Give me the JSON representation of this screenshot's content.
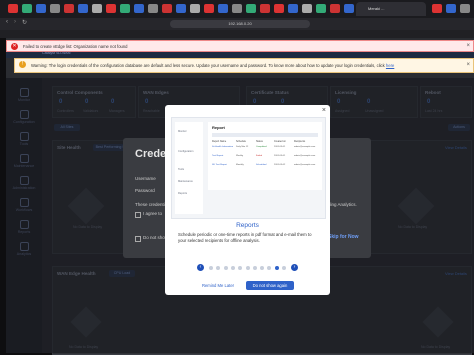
{
  "browser": {
    "tab_title": "Meraki ...",
    "url": "192.168.0.20"
  },
  "app": {
    "header_title": "Catalyst SD-WAN",
    "error_banner": "Failed to create vEdge list: Organization name not found",
    "warning_banner": "Warning: The login credentials of the configuration database are default and less secure. Update your username and password. To know more about how to update your login credentials, click",
    "warning_link": "here"
  },
  "sidebar": {
    "items": [
      {
        "label": "Monitor"
      },
      {
        "label": "Configuration"
      },
      {
        "label": "Tools"
      },
      {
        "label": "Maintenance"
      },
      {
        "label": "Administration"
      },
      {
        "label": "Workflows"
      },
      {
        "label": "Reports"
      },
      {
        "label": "Analytics"
      }
    ]
  },
  "dashboard": {
    "control_components": "Control Components",
    "wan_edges": "WAN Edges",
    "certificate_status": "Certificate Status",
    "licensing": "Licensing",
    "reboot": "Reboot",
    "cc_values": [
      "0",
      "0",
      "0"
    ],
    "cc_labels": [
      "Controllers",
      "Validators",
      "Managers"
    ],
    "wan_edges_value": "0",
    "wan_edges_label": "Reachable",
    "cert_values": [
      "0",
      "0"
    ],
    "cert_labels": [
      "Warning",
      "Expired"
    ],
    "license_values": [
      "0",
      "0"
    ],
    "license_labels": [
      "Assigned",
      "Unassigned"
    ],
    "reboot_value": "0",
    "reboot_label": "Last 24 hrs",
    "site_health": "Site Health",
    "site_health_filter": "Best Performing Sites",
    "wan_edge_health": "WAN Edge Health",
    "wan_edge_filter": "CPU Load",
    "view_details": "View Details",
    "no_data": "No Data to Display",
    "select_all": "All Sites",
    "actions": "Actions"
  },
  "credential_dialog": {
    "title": "Credentials",
    "username_label": "Username",
    "password_label": "Password",
    "body_text": "These credentials",
    "agree_text": "I agree to",
    "analytics_text": "ding Analytics.",
    "dont_show": "Do not show",
    "skip": "Skip for Now"
  },
  "modal": {
    "preview_title": "Report",
    "preview_cols": [
      "Report Name",
      "Schedule",
      "Status",
      "Created on",
      "Recipients"
    ],
    "preview_rows": [
      [
        "Sit Health Information",
        "Daily Mar 12",
        "Completed",
        "2024-03-01",
        "admin@example.com"
      ],
      [
        "Test Report",
        "Weekly",
        "Failed",
        "2024-03-01",
        "admin@example.com"
      ],
      [
        "SD Test Report",
        "Monthly",
        "Scheduled",
        "2024-03-02",
        "admin@example.com"
      ]
    ],
    "preview_nav": [
      "Monitor",
      "Configuration",
      "Tools",
      "Maintenance",
      "Reports"
    ],
    "title": "Reports",
    "description": "Schedule periodic or one-time reports in pdf format and e-mail them to your selected recipients for offline analysis.",
    "remind_later": "Remind Me Later",
    "do_not_show": "Do not show again",
    "page_count": 11,
    "current_page": 9,
    "colors": {
      "primary": "#2f62c9",
      "dot_inactive": "#c8cfdb",
      "arrow": "#1f4fb8"
    }
  }
}
